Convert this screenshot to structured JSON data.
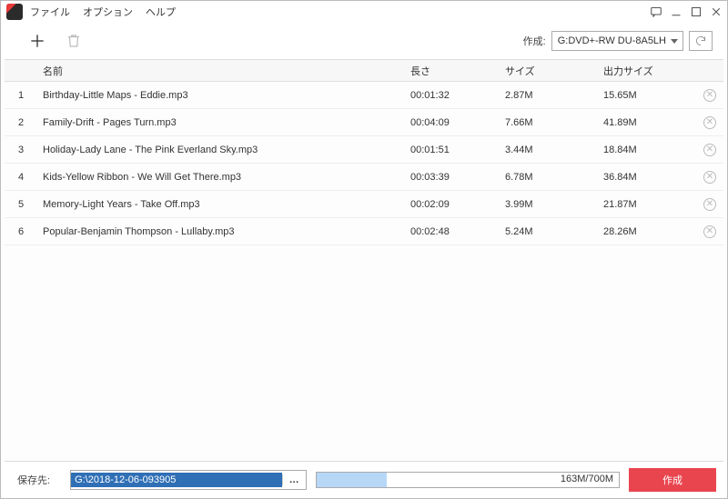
{
  "menu": {
    "file": "ファイル",
    "options": "オプション",
    "help": "ヘルプ"
  },
  "toolbar": {
    "create_label": "作成:",
    "drive_selected": "G:DVD+-RW DU-8A5LH"
  },
  "columns": {
    "index": "",
    "name": "名前",
    "length": "長さ",
    "size": "サイズ",
    "output": "出力サイズ"
  },
  "rows": [
    {
      "idx": "1",
      "name": "Birthday-Little Maps - Eddie.mp3",
      "len": "00:01:32",
      "size": "2.87M",
      "out": "15.65M"
    },
    {
      "idx": "2",
      "name": "Family-Drift - Pages Turn.mp3",
      "len": "00:04:09",
      "size": "7.66M",
      "out": "41.89M"
    },
    {
      "idx": "3",
      "name": "Holiday-Lady Lane - The Pink Everland Sky.mp3",
      "len": "00:01:51",
      "size": "3.44M",
      "out": "18.84M"
    },
    {
      "idx": "4",
      "name": "Kids-Yellow Ribbon - We Will Get There.mp3",
      "len": "00:03:39",
      "size": "6.78M",
      "out": "36.84M"
    },
    {
      "idx": "5",
      "name": "Memory-Light Years - Take Off.mp3",
      "len": "00:02:09",
      "size": "3.99M",
      "out": "21.87M"
    },
    {
      "idx": "6",
      "name": "Popular-Benjamin Thompson - Lullaby.mp3",
      "len": "00:02:48",
      "size": "5.24M",
      "out": "28.26M"
    }
  ],
  "footer": {
    "save_label": "保存先:",
    "path": "G:\\2018-12-06-093905",
    "browse": "…",
    "progress_text": "163M/700M",
    "progress_percent": 23.3,
    "create_button": "作成"
  }
}
